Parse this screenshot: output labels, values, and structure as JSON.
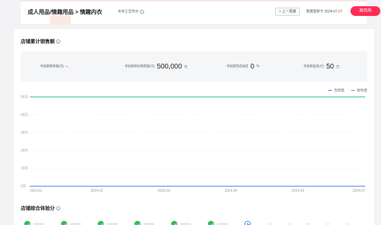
{
  "header": {
    "breadcrumb": "成人用品/情趣用品 > 情趣内衣",
    "subtitle": "考核主营类目",
    "prev_label": "< 上一周期",
    "updated": "数据更新于 2024-07-17",
    "risk_button": "高风险"
  },
  "sales": {
    "title": "店铺累计销售额",
    "stats": [
      {
        "label": "考核期销售额(元)",
        "value": "-",
        "unit": ""
      },
      {
        "label": "考核期目标销售额(元)",
        "value": "500,000",
        "unit": "元"
      },
      {
        "label": "考核期完成进度",
        "value": "0",
        "unit": "%"
      },
      {
        "label": "考核期差值(元)",
        "value": "50",
        "unit": "万"
      }
    ]
  },
  "chart_data": {
    "type": "line",
    "x": [
      "2024.01",
      "2024.02",
      "2024.03",
      "2024.04",
      "2024.05",
      "2024.07"
    ],
    "ylim": [
      0,
      50
    ],
    "y_ticks": [
      "0万",
      "10万",
      "20万",
      "30万",
      "40万",
      "50万"
    ],
    "series": [
      {
        "name": "目标值",
        "values": [
          50,
          50,
          50,
          50,
          50,
          50
        ],
        "color": "#19b48c"
      },
      {
        "name": "当前值",
        "values": [
          0,
          0,
          0,
          0,
          0,
          0
        ],
        "color": "#3b74e0"
      }
    ],
    "legend_position": "top-right",
    "grid": true
  },
  "legend": {
    "current": "当前值",
    "target": "目标值"
  },
  "score": {
    "title": "店铺综合体验分"
  }
}
